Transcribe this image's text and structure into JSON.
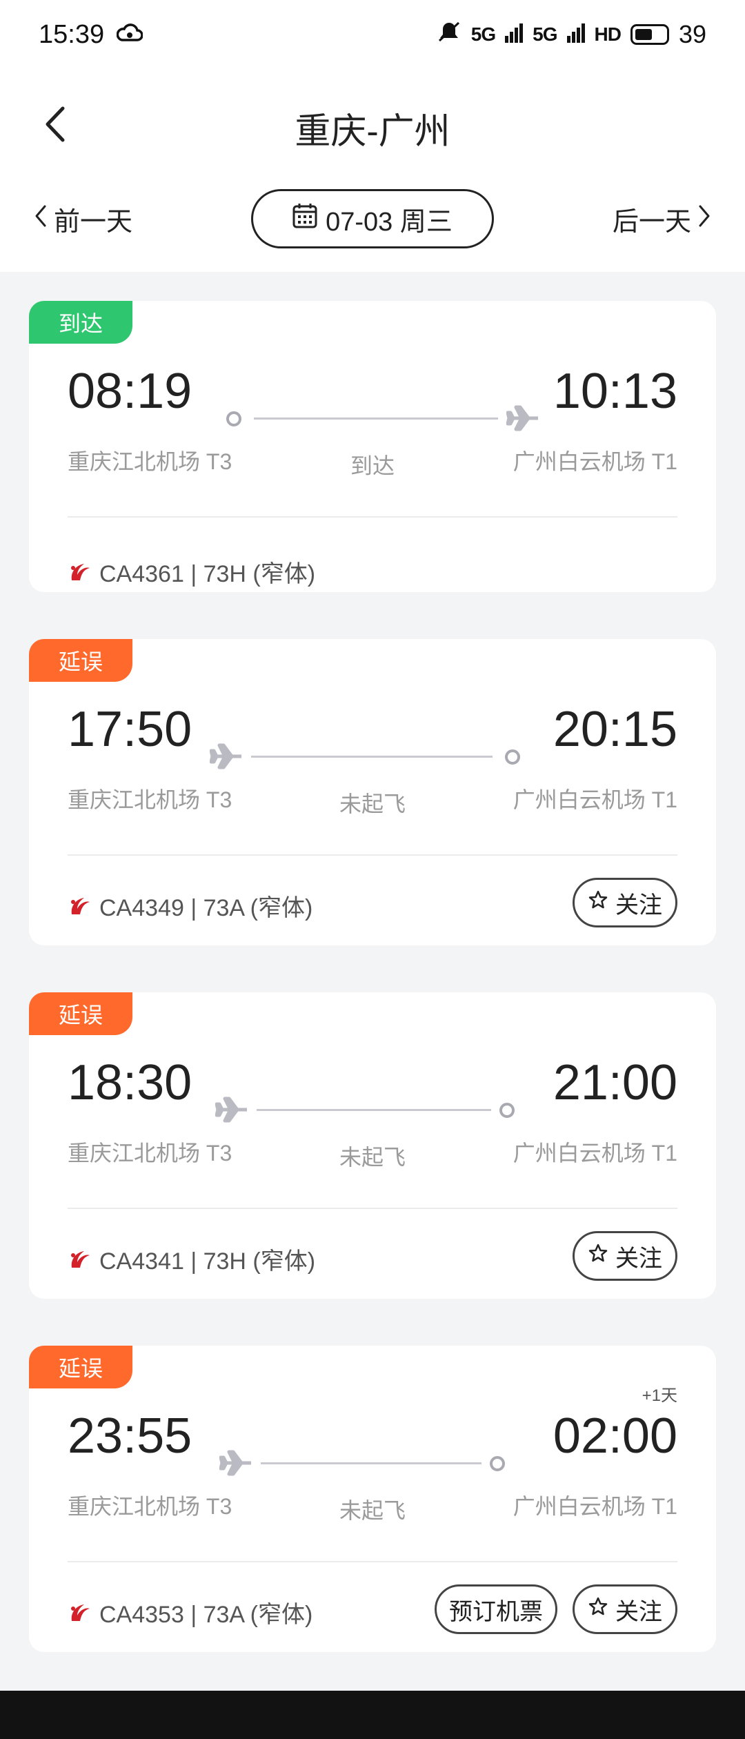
{
  "status_bar": {
    "time": "15:39",
    "signal1": "5G",
    "signal2": "5G",
    "hd": "HD",
    "battery": "39"
  },
  "header": {
    "title": "重庆-广州",
    "prev_day": "前一天",
    "next_day": "后一天",
    "date": "07-03 周三"
  },
  "flights": [
    {
      "tag": "到达",
      "tag_color": "#2ec76f",
      "dep_time": "08:19",
      "arr_time": "10:13",
      "dep_airport": "重庆江北机场 T3",
      "arr_airport": "广州白云机场 T1",
      "status": "到达",
      "flight_info": "CA4361 | 73H (窄体)"
    },
    {
      "tag": "延误",
      "tag_color": "#ff6a2c",
      "dep_time": "17:50",
      "arr_time": "20:15",
      "dep_airport": "重庆江北机场 T3",
      "arr_airport": "广州白云机场 T1",
      "status": "未起飞",
      "flight_info": "CA4349 | 73A (窄体)",
      "follow_label": "关注"
    },
    {
      "tag": "延误",
      "tag_color": "#ff6a2c",
      "dep_time": "18:30",
      "arr_time": "21:00",
      "dep_airport": "重庆江北机场 T3",
      "arr_airport": "广州白云机场 T1",
      "status": "未起飞",
      "flight_info": "CA4341 | 73H (窄体)",
      "follow_label": "关注"
    },
    {
      "tag": "延误",
      "tag_color": "#ff6a2c",
      "dep_time": "23:55",
      "arr_time": "02:00",
      "plus_day": "+1天",
      "dep_airport": "重庆江北机场 T3",
      "arr_airport": "广州白云机场 T1",
      "status": "未起飞",
      "flight_info": "CA4353 | 73A (窄体)",
      "book_label": "预订机票",
      "follow_label": "关注"
    }
  ]
}
